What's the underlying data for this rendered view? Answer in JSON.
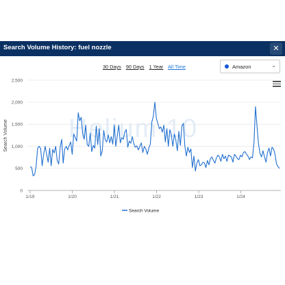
{
  "window": {
    "title": "Search Volume History: fuel nozzle",
    "close_icon": "close-icon"
  },
  "range_buttons": [
    {
      "label": "30 Days",
      "active": false
    },
    {
      "label": "90 Days",
      "active": false
    },
    {
      "label": "1 Year",
      "active": false
    },
    {
      "label": "All Time",
      "active": true
    }
  ],
  "marketplace": {
    "selected": "Amazon",
    "dot_color": "#1558d6",
    "chevron_icon": "chevron-down-icon"
  },
  "chart_menu_icon": "hamburger-menu-icon",
  "watermark": "Helium 10",
  "chart_data": {
    "type": "line",
    "xlabel": "",
    "ylabel": "Search Volume",
    "ylim": [
      0,
      2500
    ],
    "yticks": [
      "0",
      "500",
      "1,000",
      "1,500",
      "2,000",
      "2,500"
    ],
    "xticks": [
      {
        "label": "1/19",
        "x": "2019-01"
      },
      {
        "label": "1/20",
        "x": "2020-01"
      },
      {
        "label": "1/21",
        "x": "2021-01"
      },
      {
        "label": "1/22",
        "x": "2022-01"
      },
      {
        "label": "1/23",
        "x": "2023-01"
      },
      {
        "label": "1/24",
        "x": "2024-01"
      }
    ],
    "grid": true,
    "legend_position": "bottom",
    "series": [
      {
        "name": "Search Volume",
        "color": "#1f6fcf",
        "x_start": "2019-01",
        "x_end": "2024-12",
        "values": [
          540,
          520,
          330,
          360,
          560,
          960,
          1000,
          950,
          560,
          820,
          1000,
          820,
          640,
          960,
          560,
          930,
          850,
          1000,
          680,
          600,
          980,
          1160,
          620,
          940,
          1000,
          920,
          1020,
          1100,
          820,
          1280,
          1200,
          1120,
          1760,
          1580,
          1660,
          1280,
          1160,
          1480,
          1040,
          1000,
          1300,
          880,
          1020,
          960,
          1460,
          1040,
          1400,
          780,
          900,
          1360,
          1140,
          1100,
          1260,
          1080,
          1220,
          1050,
          1480,
          1000,
          1240,
          1480,
          1080,
          1200,
          1160,
          1320,
          1380,
          980,
          1120,
          1070,
          1220,
          1060,
          980,
          1010,
          920,
          1000,
          1080,
          860,
          1000,
          940,
          820,
          960,
          1050,
          1550,
          1680,
          2000,
          1640,
          1520,
          1400,
          1440,
          1320,
          1480,
          1100,
          1400,
          1000,
          1380,
          1260,
          1000,
          1280,
          1140,
          900,
          1340,
          1020,
          1460,
          1520,
          1000,
          780,
          980,
          860,
          940,
          520,
          780,
          440,
          620,
          700,
          560,
          580,
          640,
          620,
          520,
          680,
          580,
          720,
          760,
          680,
          620,
          740,
          800,
          760,
          660,
          820,
          720,
          780,
          660,
          800,
          780,
          760,
          640,
          820,
          780,
          720,
          700,
          800,
          760,
          860,
          880,
          820,
          780,
          700,
          760,
          740,
          1080,
          1900,
          1460,
          1060,
          840,
          760,
          900,
          760,
          640,
          860,
          960,
          780,
          980,
          940,
          820,
          600,
          540,
          500
        ]
      }
    ]
  }
}
